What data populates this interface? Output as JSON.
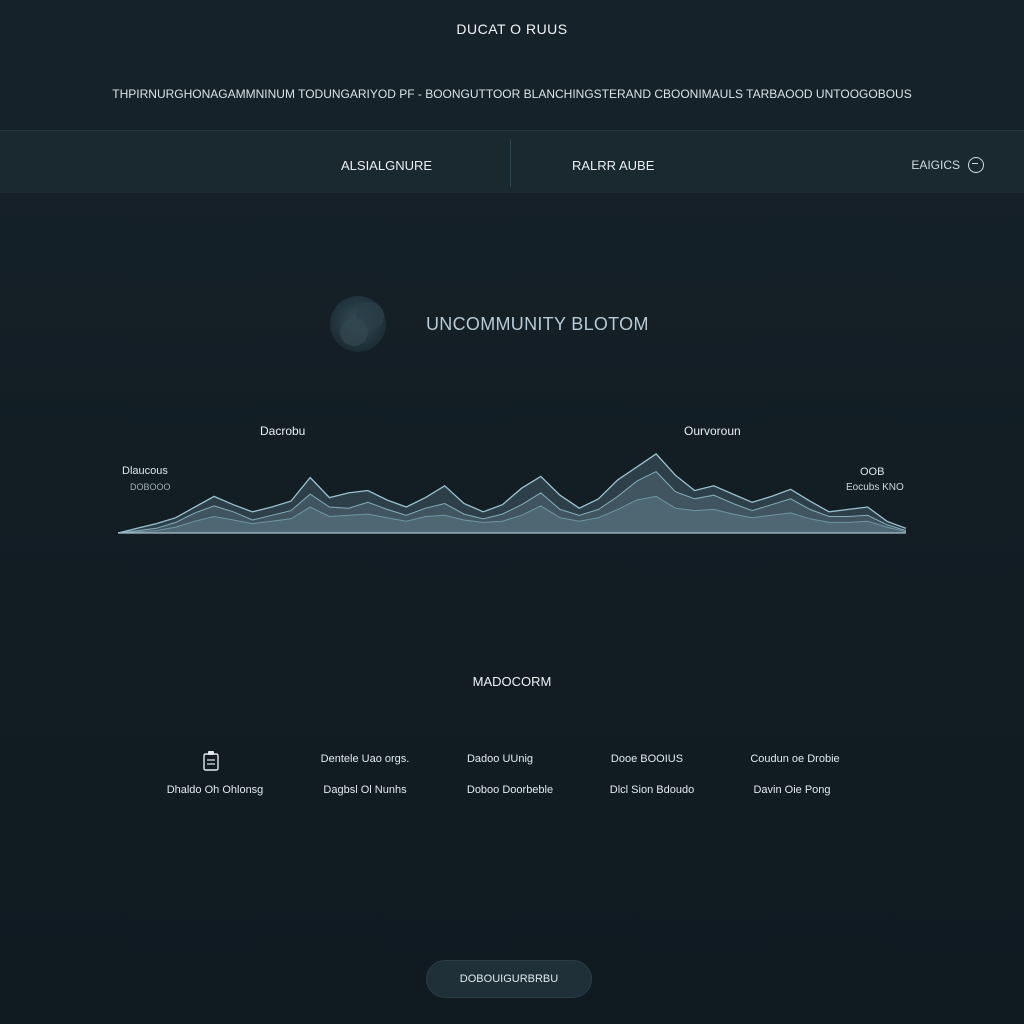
{
  "header": {
    "title": "DUCAT O RUUS",
    "tagline": "THPIRNURGHONAGAMMNINUM TODUNGARIYOD PF  -  BOONGUTTOOR  BLANCHINGSTERAND  CBOONIMAULS TARBAOOD UNTOOGOBOUS"
  },
  "nav": {
    "item1": "ALSIALGNURE",
    "item2": "RALRR AUBE",
    "right_label": "EAIGICS"
  },
  "hero": {
    "title": "UNCOMMUNITY BLOTOM"
  },
  "chart_data": {
    "type": "area",
    "labels": {
      "peak_left": "Dacrobu",
      "peak_right": "Ourvoroun",
      "side_left": "Dlaucous",
      "side_left_sub": "DOBOOO",
      "side_right": "OOB",
      "side_right_sub": "Eocubs KNO"
    },
    "series": [
      {
        "values": [
          0,
          4,
          8,
          13,
          22,
          31,
          24,
          18,
          22,
          27,
          47,
          30,
          34,
          36,
          28,
          22,
          30,
          40,
          25,
          18,
          24,
          38,
          48,
          32,
          21,
          29,
          45,
          56,
          67,
          49,
          36,
          40,
          33,
          26,
          31,
          37,
          27,
          18,
          20,
          22,
          10,
          4
        ]
      },
      {
        "values": [
          0,
          2,
          4,
          9,
          17,
          23,
          18,
          11,
          15,
          19,
          33,
          22,
          21,
          26,
          20,
          15,
          21,
          25,
          16,
          12,
          16,
          24,
          34,
          20,
          15,
          20,
          31,
          44,
          52,
          35,
          29,
          32,
          25,
          19,
          24,
          29,
          20,
          14,
          14,
          15,
          7,
          2
        ]
      },
      {
        "values": [
          0,
          1,
          2,
          5,
          10,
          14,
          11,
          8,
          10,
          12,
          22,
          14,
          15,
          16,
          13,
          10,
          14,
          15,
          11,
          9,
          10,
          15,
          23,
          13,
          10,
          13,
          20,
          28,
          31,
          21,
          19,
          20,
          16,
          13,
          15,
          17,
          12,
          9,
          9,
          10,
          5,
          1
        ]
      }
    ]
  },
  "section": {
    "title": "MADOCORM"
  },
  "grid": {
    "heads": [
      "",
      "Dentele Uao orgs.",
      "Dadoo UUnig",
      "Dooe BOOIUS",
      "Coudun oe Drobie"
    ],
    "subs": [
      "Dhaldo Oh Ohlonsg",
      "Dagbsl Ol Nunhs",
      "Doboo Doorbeble",
      "Dlcl Sion Bdoudo",
      "Davin Oie Pong"
    ]
  },
  "footer": {
    "button": "DOBOUIGURBRBU"
  },
  "colors": {
    "accent": "#8fb3c2",
    "chart_fill": "#6e8f9d",
    "bg": "#121d24"
  }
}
